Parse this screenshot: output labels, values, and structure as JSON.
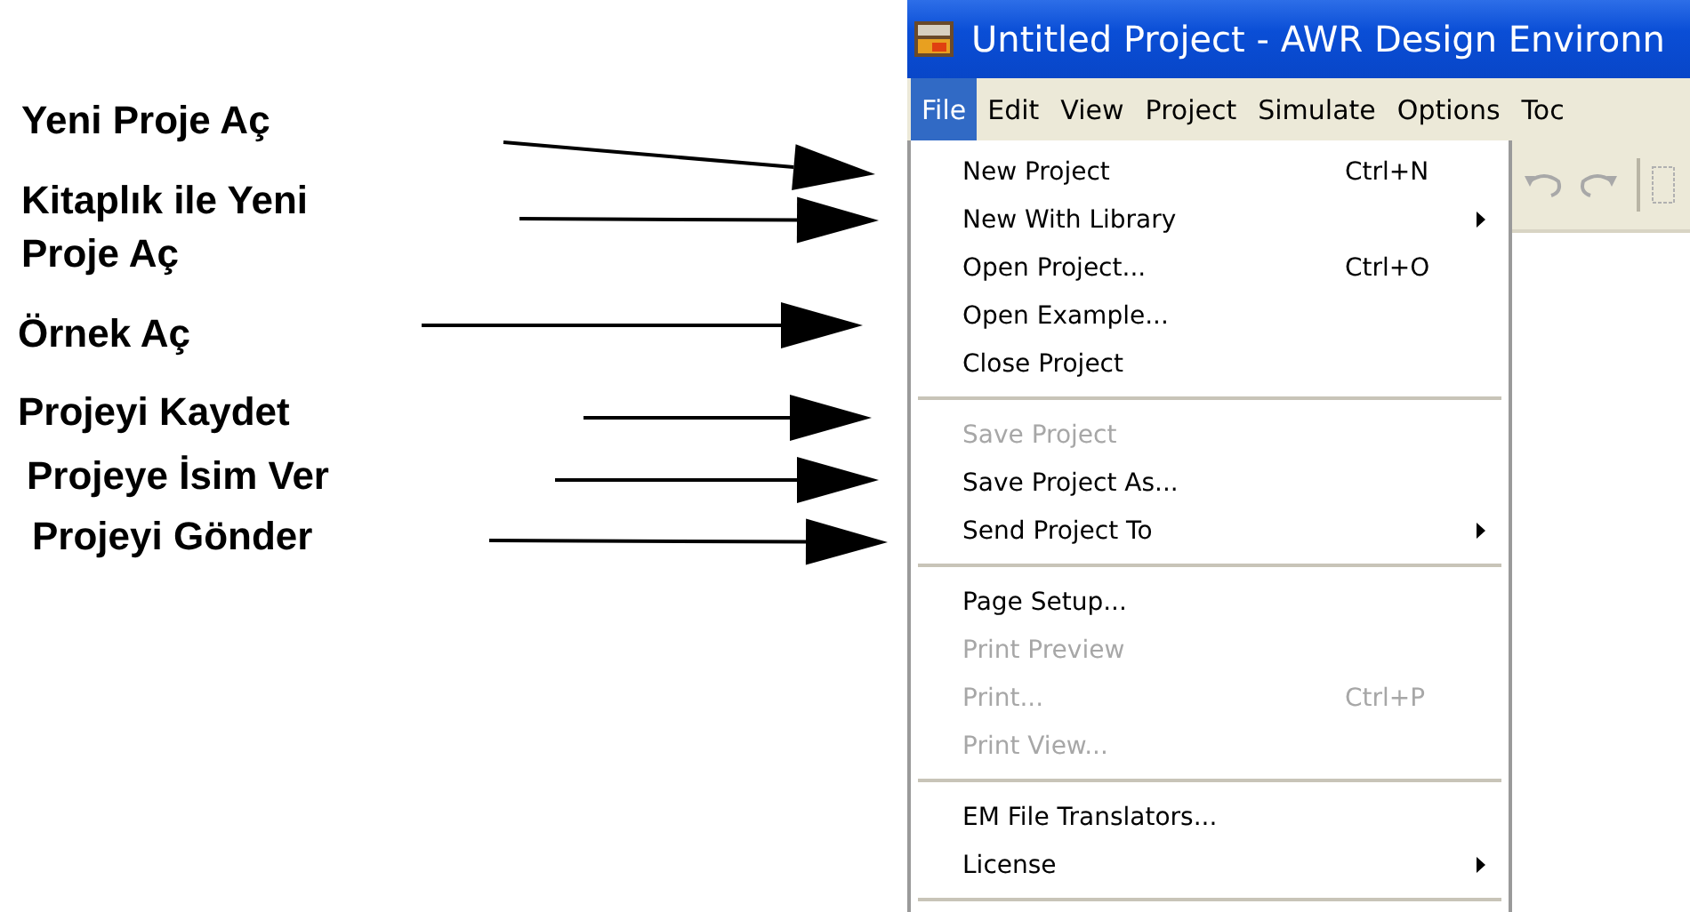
{
  "annotations": [
    {
      "text": "Yeni Proje Aç"
    },
    {
      "text": "Kitaplık ile Yeni Proje Aç"
    },
    {
      "text": "Örnek Aç"
    },
    {
      "text": "Projeyi Kaydet"
    },
    {
      "text": "Projeye İsim Ver"
    },
    {
      "text": "Projeyi Gönder"
    }
  ],
  "window": {
    "title": "Untitled Project - AWR Design Environn"
  },
  "menu_bar": [
    {
      "label": "File",
      "selected": true
    },
    {
      "label": "Edit",
      "selected": false
    },
    {
      "label": "View",
      "selected": false
    },
    {
      "label": "Project",
      "selected": false
    },
    {
      "label": "Simulate",
      "selected": false
    },
    {
      "label": "Options",
      "selected": false
    },
    {
      "label": "Toc",
      "selected": false
    }
  ],
  "file_menu": [
    {
      "kind": "item",
      "label": "New Project",
      "shortcut": "Ctrl+N",
      "disabled": false
    },
    {
      "kind": "item",
      "label": "New With Library",
      "submenu": true,
      "disabled": false
    },
    {
      "kind": "item",
      "label": "Open Project...",
      "shortcut": "Ctrl+O",
      "disabled": false
    },
    {
      "kind": "item",
      "label": "Open Example...",
      "disabled": false
    },
    {
      "kind": "item",
      "label": "Close Project",
      "disabled": false
    },
    {
      "kind": "separator"
    },
    {
      "kind": "item",
      "label": "Save Project",
      "disabled": true
    },
    {
      "kind": "item",
      "label": "Save Project As...",
      "disabled": false
    },
    {
      "kind": "item",
      "label": "Send Project To",
      "submenu": true,
      "disabled": false
    },
    {
      "kind": "separator"
    },
    {
      "kind": "item",
      "label": "Page Setup...",
      "disabled": false
    },
    {
      "kind": "item",
      "label": "Print Preview",
      "disabled": true
    },
    {
      "kind": "item",
      "label": "Print...",
      "shortcut": "Ctrl+P",
      "disabled": true
    },
    {
      "kind": "item",
      "label": "Print View...",
      "disabled": true
    },
    {
      "kind": "separator"
    },
    {
      "kind": "item",
      "label": "EM File Translators...",
      "disabled": false
    },
    {
      "kind": "item",
      "label": "License",
      "submenu": true,
      "disabled": false
    },
    {
      "kind": "separator"
    }
  ]
}
